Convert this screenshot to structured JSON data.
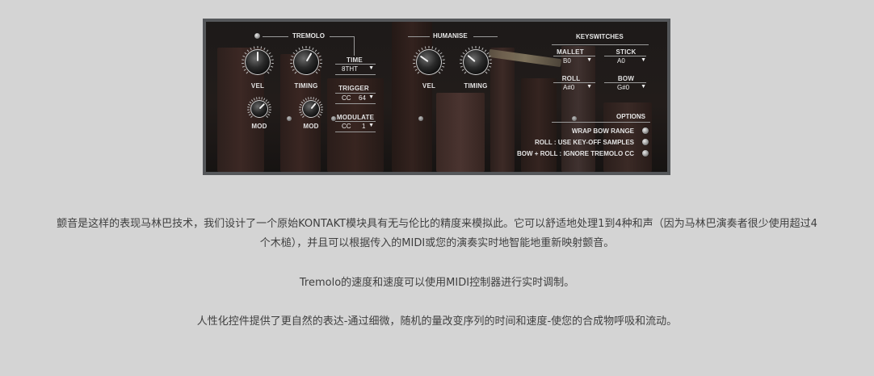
{
  "panel": {
    "tremolo": {
      "title": "TREMOLO",
      "vel_label": "VEL",
      "timing_label": "TIMING",
      "mod_label": "MOD",
      "mod2_label": "MOD",
      "time_label": "TIME",
      "time_value": "8THT",
      "trigger_label": "TRIGGER",
      "trigger_cc": "CC",
      "trigger_value": "64",
      "modulate_label": "MODULATE",
      "modulate_cc": "CC",
      "modulate_value": "1"
    },
    "humanise": {
      "title": "HUMANISE",
      "vel_label": "VEL",
      "timing_label": "TIMING"
    },
    "keyswitches": {
      "title": "KEYSWITCHES",
      "mallet_label": "MALLET",
      "mallet_value": "B0",
      "stick_label": "STICK",
      "stick_value": "A0",
      "roll_label": "ROLL",
      "roll_value": "A#0",
      "bow_label": "BOW",
      "bow_value": "G#0"
    },
    "options": {
      "title": "OPTIONS",
      "items": [
        "WRAP BOW RANGE",
        "ROLL : USE KEY-OFF SAMPLES",
        "BOW + ROLL : IGNORE TREMOLO CC"
      ]
    },
    "dropdown_arrow": "▼"
  },
  "text": {
    "p1_line1": "颤音是这样的表现马林巴技术，我们设计了一个原始KONTAKT模块具有无与伦比的精度来模拟此。它可以舒适地处理1到4种和声（因为马林巴演奏者很少使用超过4",
    "p1_line2": "个木槌），并且可以根据传入的MIDI或您的演奏实时地智能地重新映射颤音。",
    "p2": "Tremolo的速度和速度可以使用MIDI控制器进行实时调制。",
    "p3": "人性化控件提供了更自然的表达-通过细微，随机的量改变序列的时间和速度-使您的合成物呼吸和流动。"
  },
  "colors": {
    "page_bg": "#d4d4d4",
    "frame": "#55575a",
    "panel_bg": "#1d1a19",
    "wood_bar": "#3a2723",
    "body_text": "#3f3f3f"
  }
}
